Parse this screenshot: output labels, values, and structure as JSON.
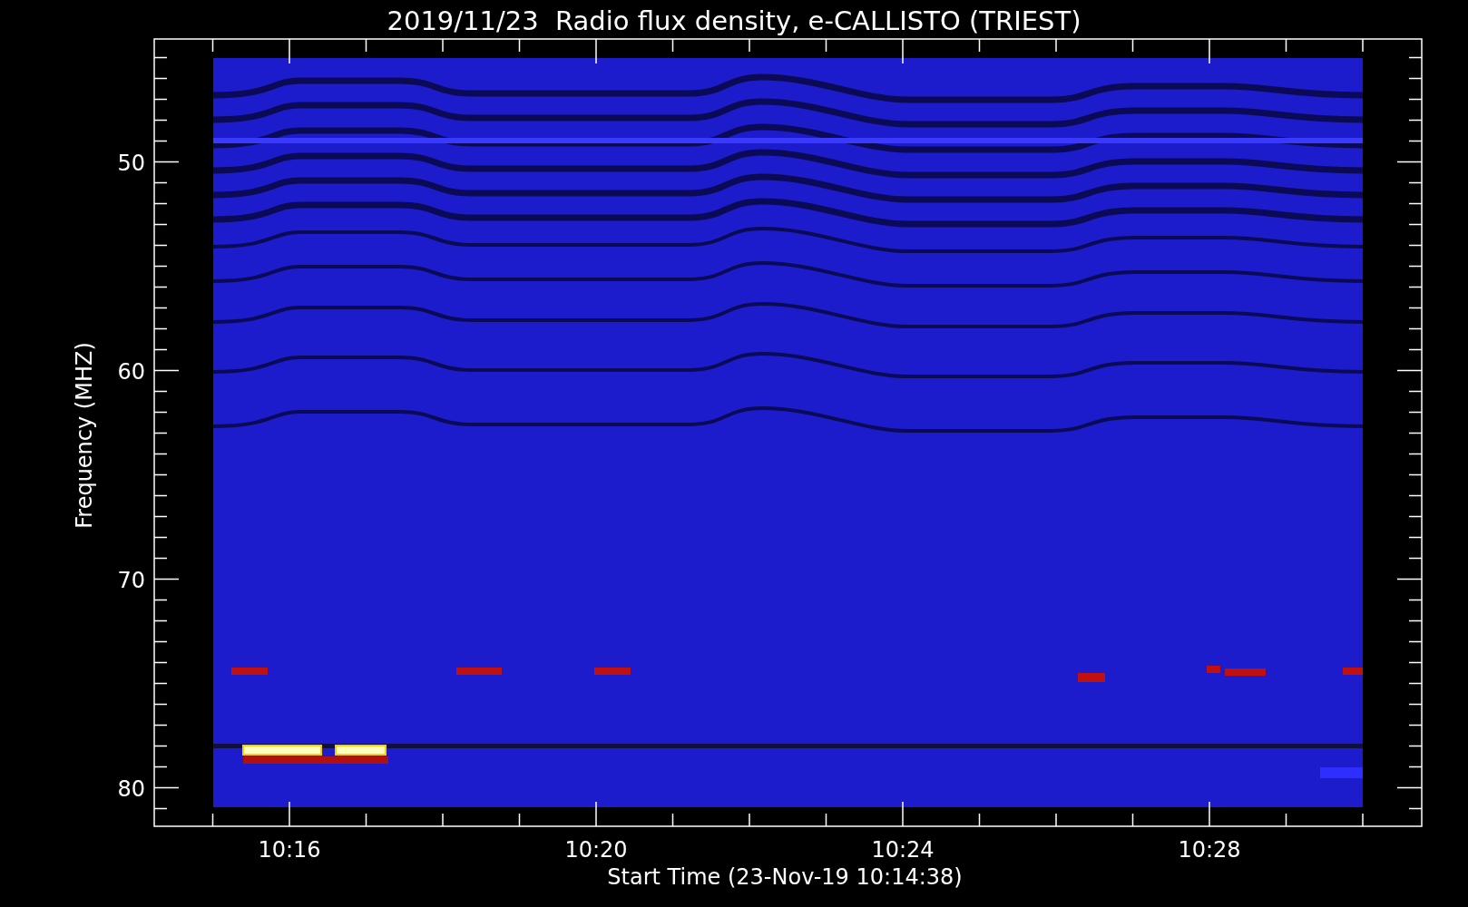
{
  "title": "2019/11/23  Radio flux density, e-CALLISTO (TRIEST)",
  "xlabel": "Start Time (23-Nov-19 10:14:38)",
  "ylabel": "Frequency (MHZ)",
  "xticks": [
    "10:16",
    "10:20",
    "10:24",
    "10:28"
  ],
  "yticks": [
    "50",
    "60",
    "70",
    "80"
  ]
}
